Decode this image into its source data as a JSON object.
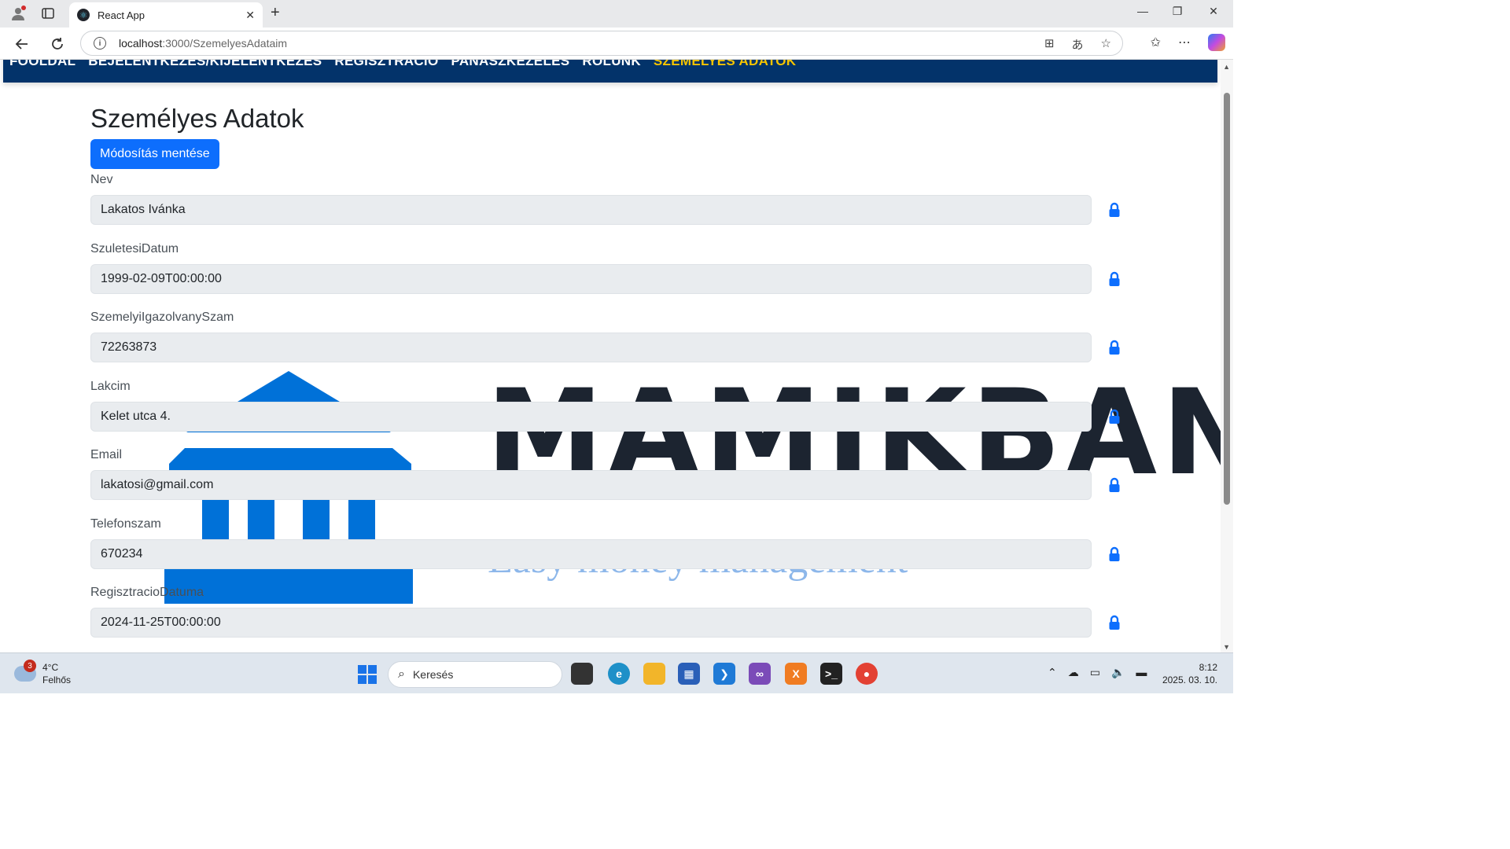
{
  "browser": {
    "tab_title": "React App",
    "url_host": "localhost",
    "url_path": ":3000/SzemelyesAdataim"
  },
  "nav": {
    "items": [
      "FŐOLDAL",
      "BEJELENTKEZÉS/KIJELENTKEZÉS",
      "REGISZTRÁCIÓ",
      "PANASZKEZELÉS",
      "RÓLUNK",
      "SZEMÉLYES ADATOK"
    ],
    "active_index": 5
  },
  "page": {
    "title": "Személyes Adatok",
    "save_label": "Módosítás mentése"
  },
  "fields": [
    {
      "label": "Nev",
      "value": "Lakatos Ivánka"
    },
    {
      "label": "SzuletesiDatum",
      "value": "1999-02-09T00:00:00"
    },
    {
      "label": "SzemelyiIgazolvanySzam",
      "value": "72263873"
    },
    {
      "label": "Lakcim",
      "value": "Kelet utca 4."
    },
    {
      "label": "Email",
      "value": "lakatosi@gmail.com"
    },
    {
      "label": "Telefonszam",
      "value": "670234"
    },
    {
      "label": "RegisztracioDatuma",
      "value": "2024-11-25T00:00:00"
    }
  ],
  "logo": {
    "brand": "MAMIKBANK",
    "slogan": "Easy money management"
  },
  "taskbar": {
    "weather_temp": "4°C",
    "weather_desc": "Felhős",
    "weather_badge": "3",
    "search_placeholder": "Keresés",
    "time": "8:12",
    "date": "2025. 03. 10."
  },
  "colors": {
    "navbar": "#03336a",
    "active_nav": "#f5c400",
    "primary": "#0d6efd",
    "logo_blue": "#0071d8"
  }
}
